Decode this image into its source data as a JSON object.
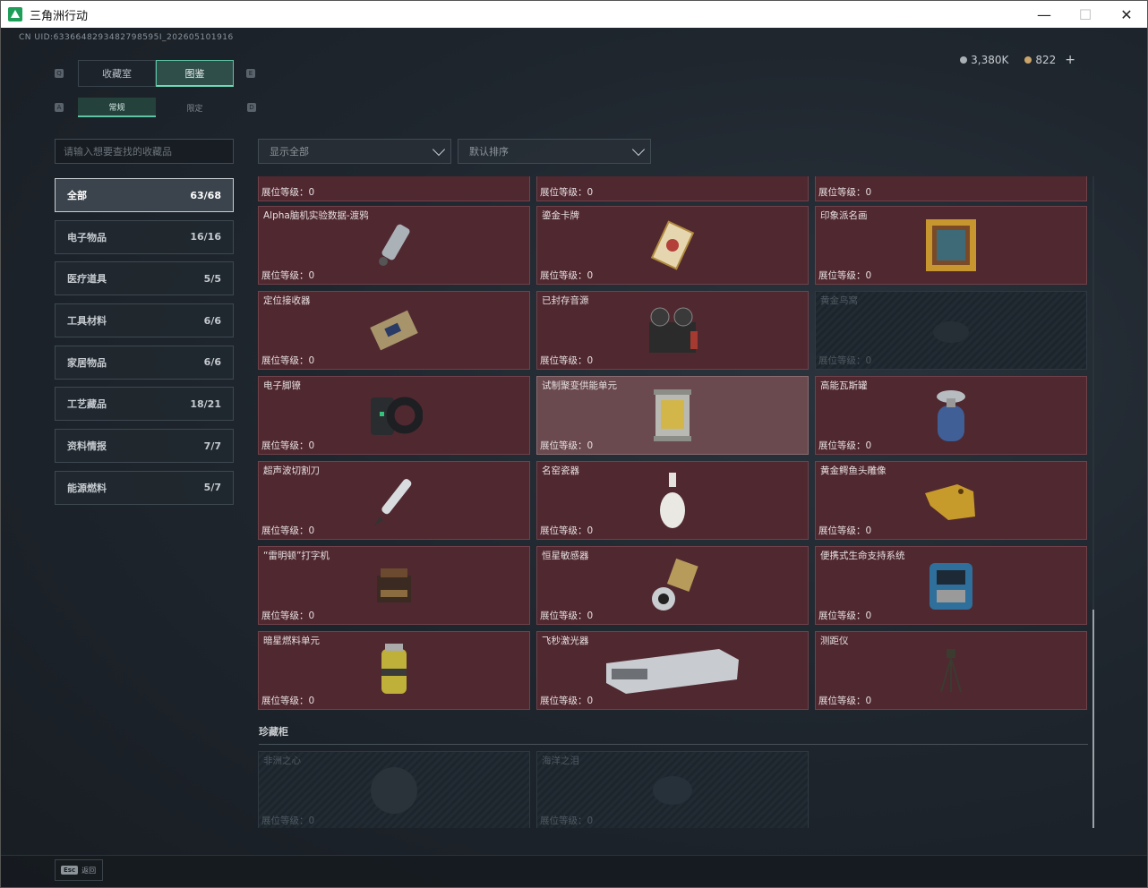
{
  "window": {
    "title": "三角洲行动",
    "minimize": "—",
    "maximize": "☐",
    "close": "✕"
  },
  "header": {
    "uid": "CN UID:6336648293482798595I_202605101916"
  },
  "currency": [
    {
      "value": "3,380K",
      "icon": "silver-coin-icon"
    },
    {
      "value": "822",
      "icon": "gold-coin-icon",
      "action": "+"
    }
  ],
  "tabs": [
    {
      "label": "收藏室"
    },
    {
      "label": "图鉴"
    }
  ],
  "subtabs": [
    {
      "label": "常规"
    },
    {
      "label": "限定"
    }
  ],
  "search": {
    "placeholder": "请输入想要查找的收藏品"
  },
  "filters": {
    "display": "显示全部",
    "sort": "默认排序"
  },
  "categories": [
    {
      "label": "全部",
      "count": "63/68"
    },
    {
      "label": "电子物品",
      "count": "16/16"
    },
    {
      "label": "医疗道具",
      "count": "5/5"
    },
    {
      "label": "工具材料",
      "count": "6/6"
    },
    {
      "label": "家居物品",
      "count": "6/6"
    },
    {
      "label": "工艺藏品",
      "count": "18/21"
    },
    {
      "label": "资料情报",
      "count": "7/7"
    },
    {
      "label": "能源燃料",
      "count": "5/7"
    }
  ],
  "level_label": "展位等级：",
  "items": [
    {
      "name": "",
      "level": "0"
    },
    {
      "name": "",
      "level": "0"
    },
    {
      "name": "",
      "level": "0"
    },
    {
      "name": "Alpha脑机实验数据-渡鸦",
      "level": "0"
    },
    {
      "name": "鎏金卡牌",
      "level": "0"
    },
    {
      "name": "印象派名画",
      "level": "0"
    },
    {
      "name": "定位接收器",
      "level": "0"
    },
    {
      "name": "已封存音源",
      "level": "0"
    },
    {
      "name": "黄金鸟窝",
      "level": "0"
    },
    {
      "name": "电子脚镣",
      "level": "0"
    },
    {
      "name": "试制聚变供能单元",
      "level": "0"
    },
    {
      "name": "高能瓦斯罐",
      "level": "0"
    },
    {
      "name": "超声波切割刀",
      "level": "0"
    },
    {
      "name": "名窑瓷器",
      "level": "0"
    },
    {
      "name": "黄金鳄鱼头雕像",
      "level": "0"
    },
    {
      "name": "“雷明顿”打字机",
      "level": "0"
    },
    {
      "name": "恒星敏感器",
      "level": "0"
    },
    {
      "name": "便携式生命支持系统",
      "level": "0"
    },
    {
      "name": "暗星燃料单元",
      "level": "0"
    },
    {
      "name": "飞秒激光器",
      "level": "0"
    },
    {
      "name": "测距仪",
      "level": "0"
    }
  ],
  "section_title": "珍藏柜",
  "cabinet": [
    {
      "name": "非洲之心",
      "level": "0"
    },
    {
      "name": "海洋之泪",
      "level": "0"
    }
  ],
  "footer": {
    "key": "Esc",
    "label": "返回"
  }
}
